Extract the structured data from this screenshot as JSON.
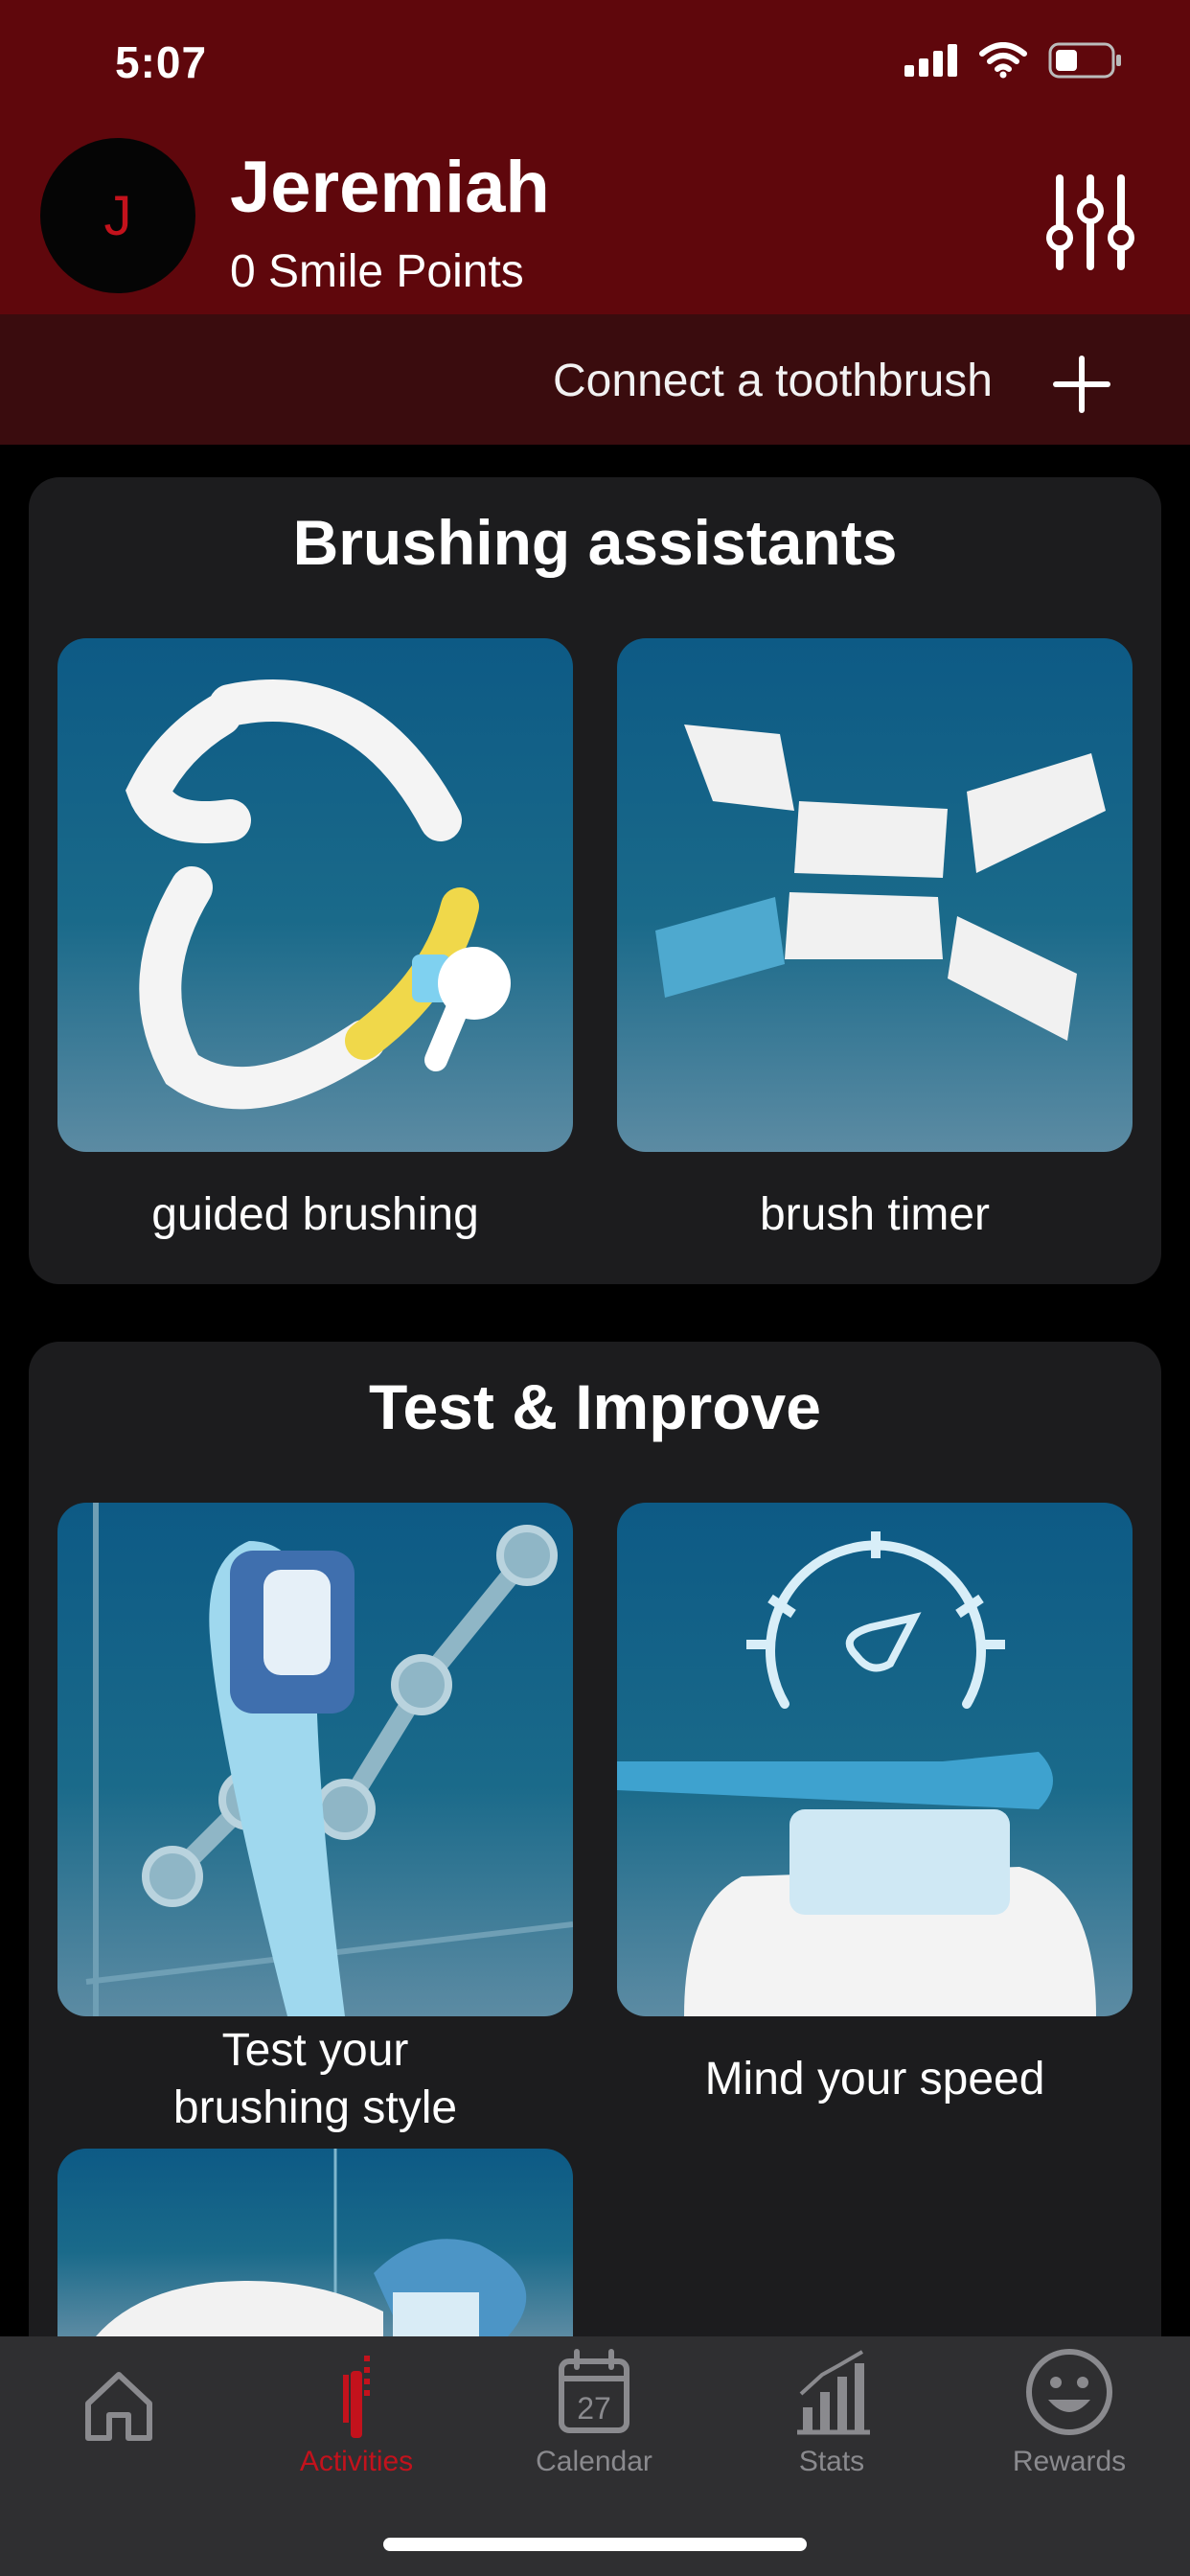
{
  "status": {
    "time": "5:07"
  },
  "user": {
    "initial": "J",
    "name": "Jeremiah",
    "points": "0 Smile Points"
  },
  "connect": {
    "label": "Connect a toothbrush"
  },
  "brushing_assistants": {
    "title": "Brushing assistants",
    "items": [
      {
        "label": "guided brushing",
        "icon": "teeth-arch-illustration"
      },
      {
        "label": "brush timer",
        "icon": "mouth-segments-illustration"
      }
    ]
  },
  "test_improve": {
    "title": "Test & Improve",
    "items": [
      {
        "label": "Test your brushing style",
        "label_line1": "Test your",
        "label_line2": "brushing style",
        "icon": "toothbrush-chart-illustration"
      },
      {
        "label": "Mind your speed",
        "icon": "speedometer-illustration"
      },
      {
        "label": "",
        "icon": "brush-tooth-illustration"
      }
    ]
  },
  "tabs": [
    {
      "label": "",
      "icon": "home-icon",
      "active": false
    },
    {
      "label": "Activities",
      "icon": "toothbrush-icon",
      "active": true
    },
    {
      "label": "Calendar",
      "icon": "calendar-icon",
      "calendar_day": "27",
      "active": false
    },
    {
      "label": "Stats",
      "icon": "bar-chart-icon",
      "active": false
    },
    {
      "label": "Rewards",
      "icon": "smiley-icon",
      "active": false
    }
  ],
  "colors": {
    "header": "#5f070c",
    "connect_bar": "#3a0c0e",
    "accent": "#c3121c",
    "card": "#1c1c1e"
  }
}
